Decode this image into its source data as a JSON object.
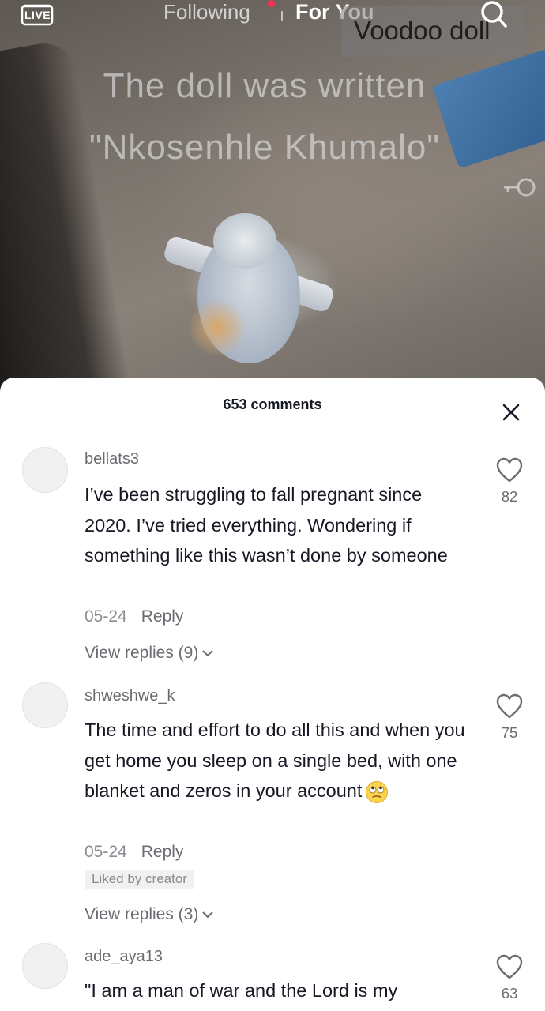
{
  "header": {
    "live_label": "LIVE",
    "tab_following": "Following",
    "tab_for_you": "For You",
    "search_query": "Voodoo doll"
  },
  "video": {
    "overlay_line_1": "The doll was written",
    "overlay_line_2": "\"Nkosenhle Khumalo\""
  },
  "comments_sheet": {
    "title": "653 comments",
    "comments": [
      {
        "username": "bellats3",
        "text": "I’ve been struggling to fall pregnant since 2020. I’ve tried everything. Wondering if something like this wasn’t done by someone",
        "date": "05-24",
        "reply_label": "Reply",
        "likes": "82",
        "view_replies": "View replies (9)"
      },
      {
        "username": "shweshwe_k",
        "text": "The time and effort to do all this and when you get home you sleep on a single bed, with one blanket and zeros in your account",
        "emoji": "eye-roll-emoji",
        "date": "05-24",
        "reply_label": "Reply",
        "badge": "Liked by creator",
        "likes": "75",
        "view_replies": "View replies (3)"
      },
      {
        "username": "ade_aya13",
        "text": "\"I am a man of war and the Lord is my",
        "likes": "63"
      }
    ]
  },
  "colors": {
    "accent_red": "#fe2c55",
    "text_primary": "#161823",
    "text_secondary": "#8a8b91"
  }
}
